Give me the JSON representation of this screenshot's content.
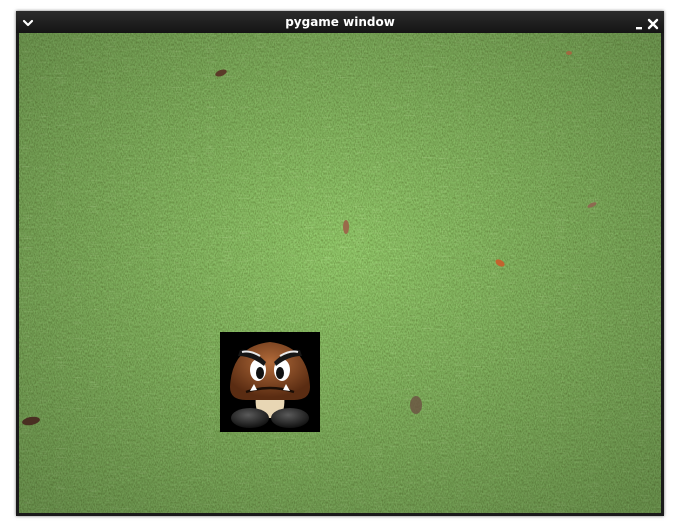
{
  "window": {
    "title": "pygame window",
    "controls": {
      "menu_icon": "chevron-down-icon",
      "minimize_icon": "minimize-icon",
      "close_icon": "close-icon"
    },
    "titlebar_color": "#1e1e1e",
    "title_color": "#ffffff"
  },
  "game": {
    "background": {
      "name": "grass-lawn",
      "base_color": "#3f7a25",
      "highlight_color": "#6aa63c",
      "shadow_color": "#24501a"
    },
    "sprites": [
      {
        "name": "goomba",
        "sprite_background": "#000000",
        "body_color": "#8b4a24",
        "feet_color": "#2a2a2a"
      }
    ],
    "debris": [
      "dry-leaf",
      "dry-leaf",
      "dry-leaf",
      "orange-leaf",
      "dry-leaf",
      "dry-leaf"
    ]
  }
}
